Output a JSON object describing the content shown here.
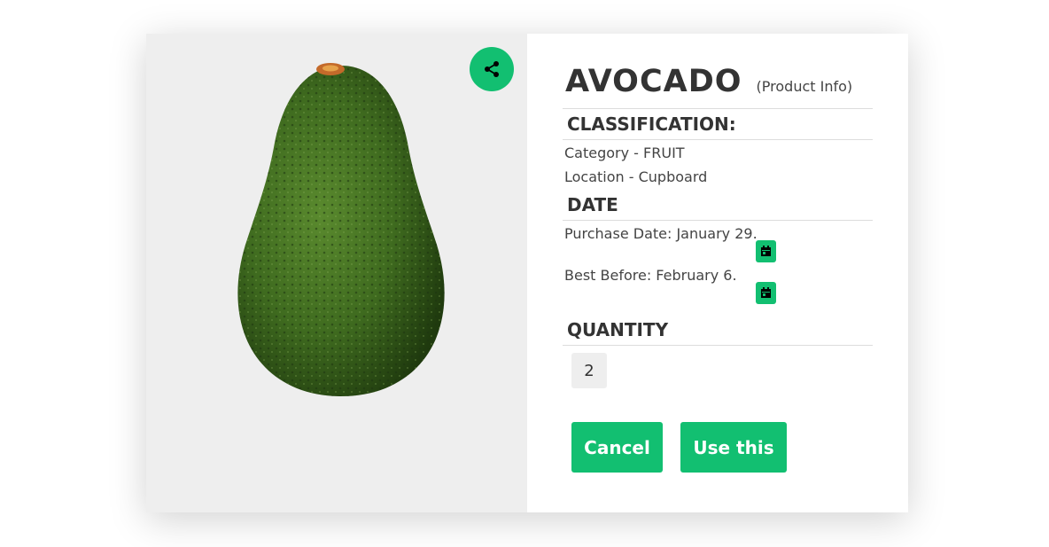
{
  "product": {
    "name": "AVOCADO",
    "subtitle": "(Product Info)",
    "image_icon": "avocado-photo"
  },
  "share": {
    "icon": "share-icon"
  },
  "classification": {
    "heading": "CLASSIFICATION:",
    "category": "Category - FRUIT",
    "location": "Location - Cupboard"
  },
  "date": {
    "heading": "DATE",
    "purchase": "Purchase Date: January 29.",
    "best_before": "Best Before: February 6.",
    "calendar_icon": "calendar-icon"
  },
  "quantity": {
    "heading": "QUANTITY",
    "value": "2"
  },
  "actions": {
    "cancel": "Cancel",
    "use": "Use this"
  },
  "colors": {
    "accent": "#12bf71",
    "image_bg": "#eeeeee",
    "text": "#333333"
  }
}
